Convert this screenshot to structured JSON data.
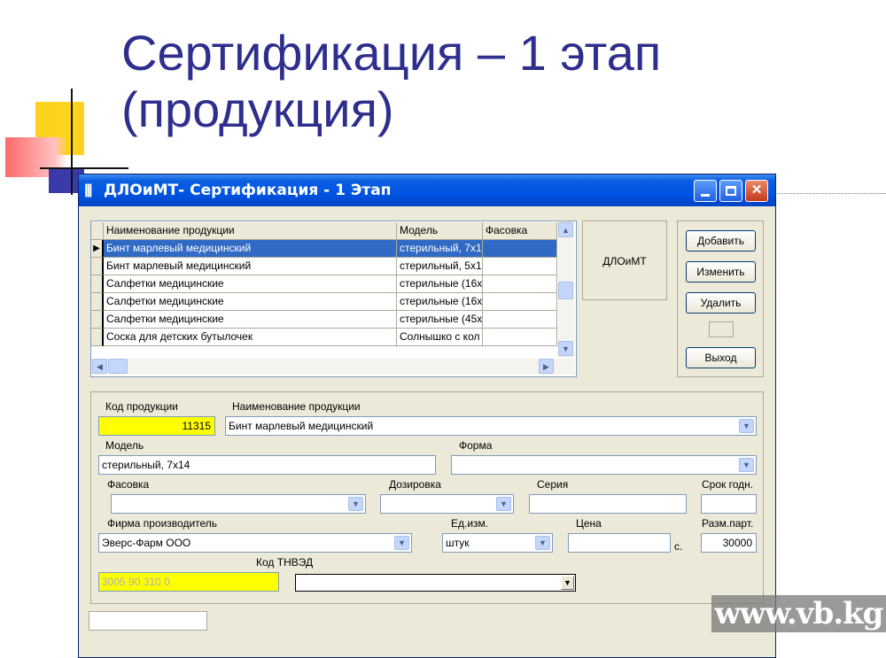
{
  "slide": {
    "title_line1": "Сертификация – 1 этап",
    "title_line2": "(продукция)"
  },
  "window": {
    "title": "ДЛОиМТ- Сертификация - 1 Этап",
    "icon_glyph": "|||"
  },
  "grid": {
    "columns": [
      "Наименование продукции",
      "Модель",
      "Фасовка"
    ],
    "rows": [
      {
        "name": "Бинт марлевый медицинский",
        "model": "стерильный, 7х1",
        "pack": "",
        "selected": true
      },
      {
        "name": "Бинт марлевый медицинский",
        "model": "стерильный, 5х1",
        "pack": ""
      },
      {
        "name": "Салфетки медицинские",
        "model": "стерильные (16х",
        "pack": ""
      },
      {
        "name": "Салфетки медицинские",
        "model": "стерильные (16х",
        "pack": ""
      },
      {
        "name": "Салфетки медицинские",
        "model": "стерильные (45х",
        "pack": ""
      },
      {
        "name": "Соска для детских бутылочек",
        "model": "Солнышко с кол",
        "pack": ""
      }
    ]
  },
  "brand": "ДЛОиМТ",
  "buttons": {
    "add": "Добавить",
    "edit": "Изменить",
    "delete": "Удалить",
    "exit": "Выход"
  },
  "form": {
    "code_label": "Код продукции",
    "code_value": "11315",
    "name_label": "Наименование продукции",
    "name_value": "Бинт марлевый медицинский",
    "model_label": "Модель",
    "model_value": "стерильный, 7х14",
    "form_label": "Форма",
    "form_value": "",
    "pack_label": "Фасовка",
    "pack_value": "",
    "dosage_label": "Дозировка",
    "dosage_value": "",
    "series_label": "Серия",
    "series_value": "",
    "shelf_label": "Срок годн.",
    "shelf_value": "",
    "maker_label": "Фирма производитель",
    "maker_value": "Эверс-Фарм ООО",
    "unit_label": "Ед.изм.",
    "unit_value": "штук",
    "price_label": "Цена",
    "price_value": "",
    "currency": "с.",
    "batch_label": "Разм.парт.",
    "batch_value": "30000",
    "tnved_label": "Код ТНВЭД",
    "tnved_code": "3005 90 310 0",
    "tnved_value": ""
  },
  "watermark": "www.vb.kg",
  "colors": {
    "title": "#2e2e8e",
    "titlebar": "#0054e3",
    "selection": "#316ac5",
    "highlight_field": "#ffff00"
  }
}
